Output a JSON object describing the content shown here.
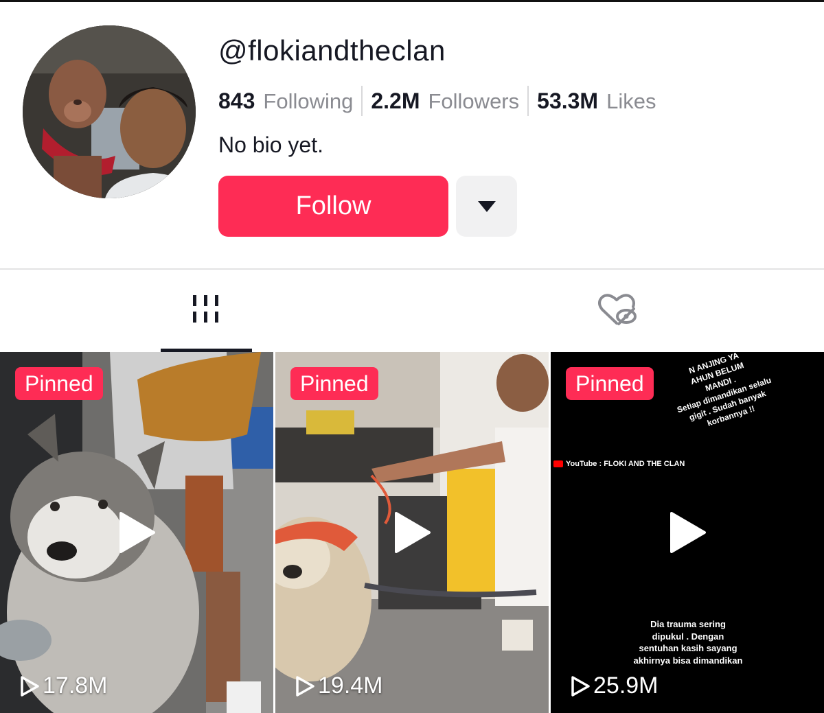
{
  "profile": {
    "username": "@flokiandtheclan",
    "bio": "No bio yet."
  },
  "stats": {
    "following": {
      "value": "843",
      "label": "Following"
    },
    "followers": {
      "value": "2.2M",
      "label": "Followers"
    },
    "likes": {
      "value": "53.3M",
      "label": "Likes"
    }
  },
  "actions": {
    "follow_label": "Follow",
    "more_icon": "caret-down-icon"
  },
  "tabs": [
    {
      "name": "videos",
      "icon": "grid-icon",
      "active": true
    },
    {
      "name": "liked",
      "icon": "heart-hidden-icon",
      "active": false
    }
  ],
  "videos": [
    {
      "badge": "Pinned",
      "views": "17.8M"
    },
    {
      "badge": "Pinned",
      "views": "19.4M"
    },
    {
      "badge": "Pinned",
      "views": "25.9M",
      "overlay_top": [
        "N ANJING YA",
        "AHUN BELUM",
        "MANDI .",
        "Setiap dimandikan selalu",
        "gigit . Sudah banyak",
        "korbannya !!"
      ],
      "overlay_mid": "YouTube : FLOKI AND THE CLAN",
      "overlay_bottom": [
        "Dia trauma sering",
        "dipukul . Dengan",
        "sentuhan kasih sayang",
        "akhirnya bisa dimandikan"
      ]
    }
  ],
  "colors": {
    "brand": "#fe2c55",
    "text": "#161823",
    "muted": "#8a8b91"
  }
}
